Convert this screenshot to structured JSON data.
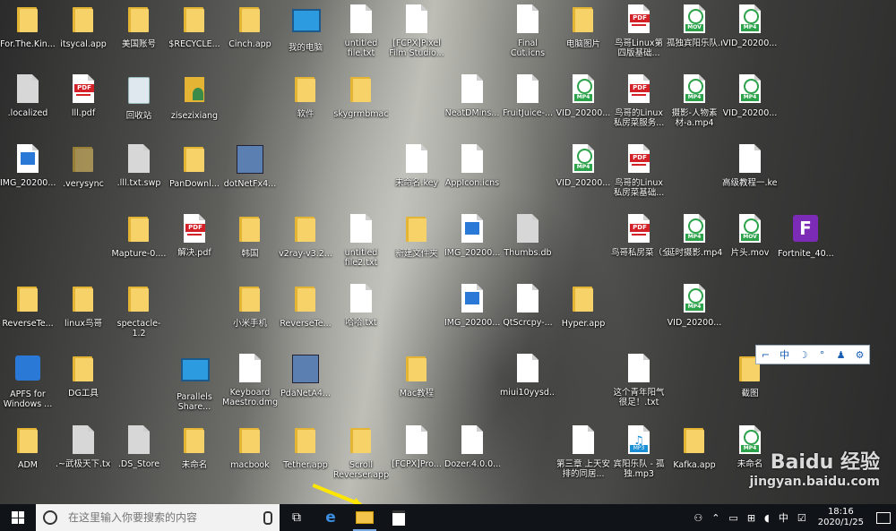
{
  "desktop": {
    "icons": [
      {
        "label": "For.The.Kin...",
        "type": "folder"
      },
      {
        "label": "itsycal.app",
        "type": "folder"
      },
      {
        "label": "美国账号",
        "type": "folder"
      },
      {
        "label": "$RECYCLE...",
        "type": "folder"
      },
      {
        "label": "Cinch.app",
        "type": "folder"
      },
      {
        "label": "我的电脑",
        "type": "computer"
      },
      {
        "label": "untitled file.txt",
        "type": "file"
      },
      {
        "label": "[FCPX]Pixel Film Studio...",
        "type": "file"
      },
      {
        "label": "Final Cut.icns",
        "type": "file"
      },
      {
        "label": "电脑图片",
        "type": "folder"
      },
      {
        "label": "鸟哥Linux第四版基础...",
        "type": "pdf"
      },
      {
        "label": "孤独宾阳乐队.mov",
        "type": "mov"
      },
      {
        "label": "VID_20200...",
        "type": "mp4"
      },
      {
        "label": ".localized",
        "type": "file-grey"
      },
      {
        "label": "lll.pdf",
        "type": "pdf"
      },
      {
        "label": "回收站",
        "type": "trash"
      },
      {
        "label": "zisezixiang",
        "type": "person"
      },
      {
        "label": "软件",
        "type": "folder"
      },
      {
        "label": "skygrmbmac",
        "type": "folder"
      },
      {
        "label": "NeatDMins...",
        "type": "file"
      },
      {
        "label": "FruitJuice-...",
        "type": "file"
      },
      {
        "label": "VID_20200...",
        "type": "mp4"
      },
      {
        "label": "鸟哥的Linux私房菜服务...",
        "type": "pdf"
      },
      {
        "label": "摄影-人物素材-a.mp4",
        "type": "mp4"
      },
      {
        "label": "VID_20200...",
        "type": "mp4"
      },
      {
        "label": "IMG_20200...",
        "type": "img"
      },
      {
        "label": ".verysync",
        "type": "folder-dim"
      },
      {
        "label": ".lll.txt.swp",
        "type": "file-grey"
      },
      {
        "label": "PanDownl...",
        "type": "folder"
      },
      {
        "label": "dotNetFx4...",
        "type": "installer"
      },
      {
        "label": "未命名.key",
        "type": "file"
      },
      {
        "label": "AppIcon.icns",
        "type": "file"
      },
      {
        "label": "VID_20200...",
        "type": "mp4"
      },
      {
        "label": "鸟哥的Linux私房菜基础...",
        "type": "pdf"
      },
      {
        "label": "高级教程一.key",
        "type": "file"
      },
      {
        "label": "Mapture-0....",
        "type": "folder"
      },
      {
        "label": "解决.pdf",
        "type": "pdf"
      },
      {
        "label": "韩国",
        "type": "folder"
      },
      {
        "label": "v2ray-v3.2...",
        "type": "folder"
      },
      {
        "label": "untitled file2.txt",
        "type": "file"
      },
      {
        "label": "新建文件夹",
        "type": "folder"
      },
      {
        "label": "IMG_20200...",
        "type": "img"
      },
      {
        "label": "Thumbs.db",
        "type": "file-grey"
      },
      {
        "label": "鸟哥私房菜（全）.pdf",
        "type": "pdf"
      },
      {
        "label": "延时摄影.mp4",
        "type": "mp4"
      },
      {
        "label": "片头.mov",
        "type": "mov"
      },
      {
        "label": "Fortnite_40...",
        "type": "purple"
      },
      {
        "label": "ReverseTe...",
        "type": "folder"
      },
      {
        "label": "linux鸟哥",
        "type": "folder"
      },
      {
        "label": "spectacle-1.2",
        "type": "folder"
      },
      {
        "label": "小米手机",
        "type": "folder"
      },
      {
        "label": "ReverseTe...",
        "type": "folder"
      },
      {
        "label": "哈哈.txt",
        "type": "file"
      },
      {
        "label": "IMG_20200...",
        "type": "img"
      },
      {
        "label": "QtScrcpy-...",
        "type": "file"
      },
      {
        "label": "Hyper.app",
        "type": "folder"
      },
      {
        "label": "VID_20200...",
        "type": "mp4"
      },
      {
        "label": "APFS for Windows ...",
        "type": "app-blue"
      },
      {
        "label": "DG工具",
        "type": "folder"
      },
      {
        "label": "Parallels Share...",
        "type": "computer"
      },
      {
        "label": "Keyboard Maestro.dmg",
        "type": "file"
      },
      {
        "label": "PdaNetA4...",
        "type": "installer"
      },
      {
        "label": "Mac教程",
        "type": "folder"
      },
      {
        "label": "miui10yysd...",
        "type": "file"
      },
      {
        "label": "这个青年阳气很足！.txt",
        "type": "file"
      },
      {
        "label": "截图",
        "type": "folder"
      },
      {
        "label": "ADM",
        "type": "folder"
      },
      {
        "label": ".~武极天下.txt",
        "type": "file-grey"
      },
      {
        "label": ".DS_Store",
        "type": "file-grey"
      },
      {
        "label": "未命名",
        "type": "folder"
      },
      {
        "label": "macbook",
        "type": "folder"
      },
      {
        "label": "Tether.app",
        "type": "folder"
      },
      {
        "label": "Scroll Reverser.app",
        "type": "folder"
      },
      {
        "label": "[FCPX]Pro...",
        "type": "file"
      },
      {
        "label": "Dozer.4.0.0...",
        "type": "file"
      },
      {
        "label": "第三章 上天安排的同居...",
        "type": "file"
      },
      {
        "label": "宾阳乐队 - 孤独.mp3",
        "type": "music"
      },
      {
        "label": "Kafka.app",
        "type": "folder"
      },
      {
        "label": "未命名",
        "type": "mp4"
      }
    ]
  },
  "ime_bar": {
    "items": [
      "中",
      "☽",
      "°",
      "⚙"
    ]
  },
  "taskbar": {
    "search_placeholder": "在这里输入你要搜索的内容",
    "tray_lang": "中",
    "time": "18:16",
    "date": "2020/1/25"
  },
  "watermark": {
    "line1": "Baidu 经验",
    "line2": "jingyan.baidu.com"
  }
}
